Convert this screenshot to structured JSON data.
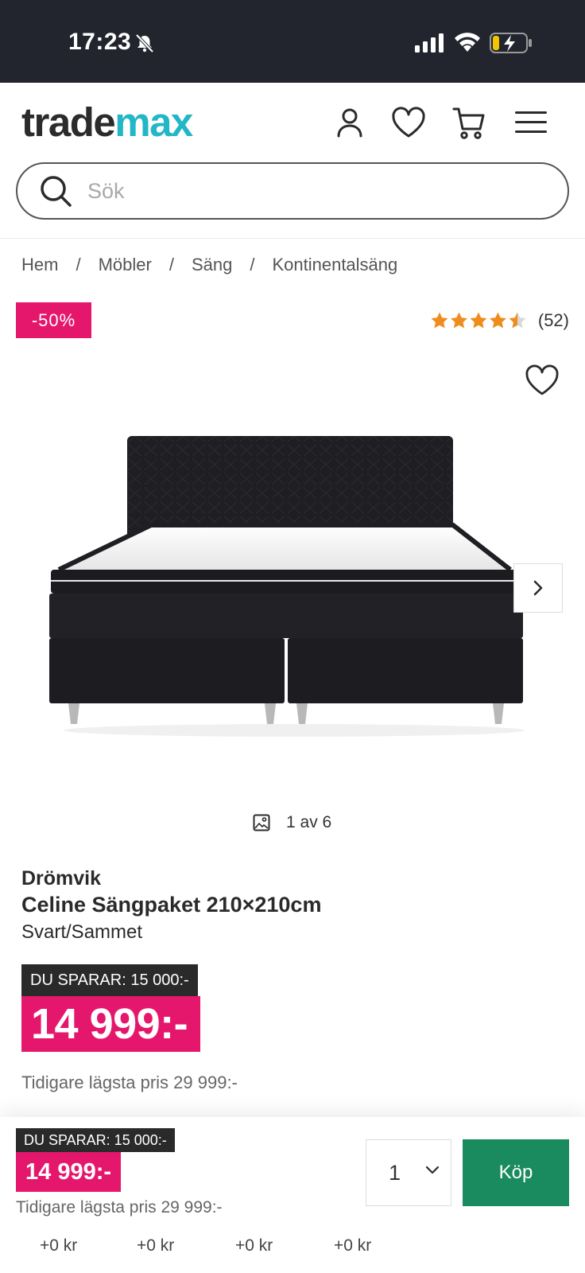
{
  "status_bar": {
    "time": "17:23"
  },
  "header": {
    "logo_part1": "trade",
    "logo_part2": "max",
    "search_placeholder": "Sök",
    "colors": {
      "brand_teal": "#22b6c6",
      "dark": "#2b2b2b"
    }
  },
  "breadcrumb": [
    "Hem",
    "Möbler",
    "Säng",
    "Kontinentalsäng"
  ],
  "breadcrumb_separator": "/",
  "product": {
    "discount_badge": "-50%",
    "rating_value": 4.5,
    "rating_max": 5,
    "rating_count": "(52)",
    "gallery_count": "1 av 6",
    "brand": "Drömvik",
    "title": "Celine Sängpaket 210×210cm",
    "variant": "Svart/Sammet",
    "savings": "DU SPARAR: 15 000:-",
    "price": "14 999:-",
    "previous_price": "Tidigare lägsta pris 29 999:-"
  },
  "sticky_bar": {
    "savings": "DU SPARAR: 15 000:-",
    "price": "14 999:-",
    "previous_price": "Tidigare lägsta pris 29 999:-",
    "quantity": "1",
    "buy_label": "Köp"
  },
  "addons": [
    "+0 kr",
    "+0 kr",
    "+0 kr",
    "+0 kr"
  ],
  "colors": {
    "pink": "#e5176c",
    "buy_green": "#1a8a5f",
    "star_orange": "#ef8c1e",
    "status_bar_bg": "#22252e"
  }
}
